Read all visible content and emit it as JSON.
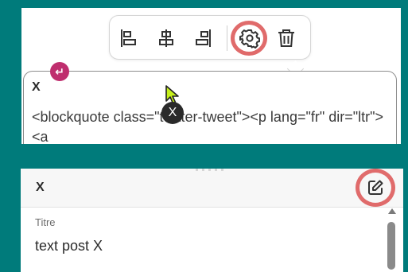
{
  "editor_block": {
    "title": "X",
    "embed_code": "<blockquote class=\"twitter-tweet\"><p lang=\"fr\" dir=\"ltr\"><a",
    "toolbar": {
      "buttons": [
        {
          "id": "align-left",
          "icon": "align-left-icon"
        },
        {
          "id": "align-center",
          "icon": "align-center-icon"
        },
        {
          "id": "align-right",
          "icon": "align-right-icon"
        },
        {
          "id": "settings",
          "icon": "gear-icon",
          "highlighted": true
        },
        {
          "id": "delete",
          "icon": "trash-icon"
        }
      ]
    },
    "return_badge_symbol": "↵",
    "cursor_tooltip": "X"
  },
  "settings_card": {
    "title": "X",
    "edit_icon": "edit-icon",
    "edit_highlighted": true,
    "field_label": "Titre",
    "field_value": "text post X"
  },
  "colors": {
    "background": "#007b7b",
    "highlight_ring": "#e06b6b",
    "return_badge": "#bf2e6e",
    "cursor": "#c6f01b"
  }
}
